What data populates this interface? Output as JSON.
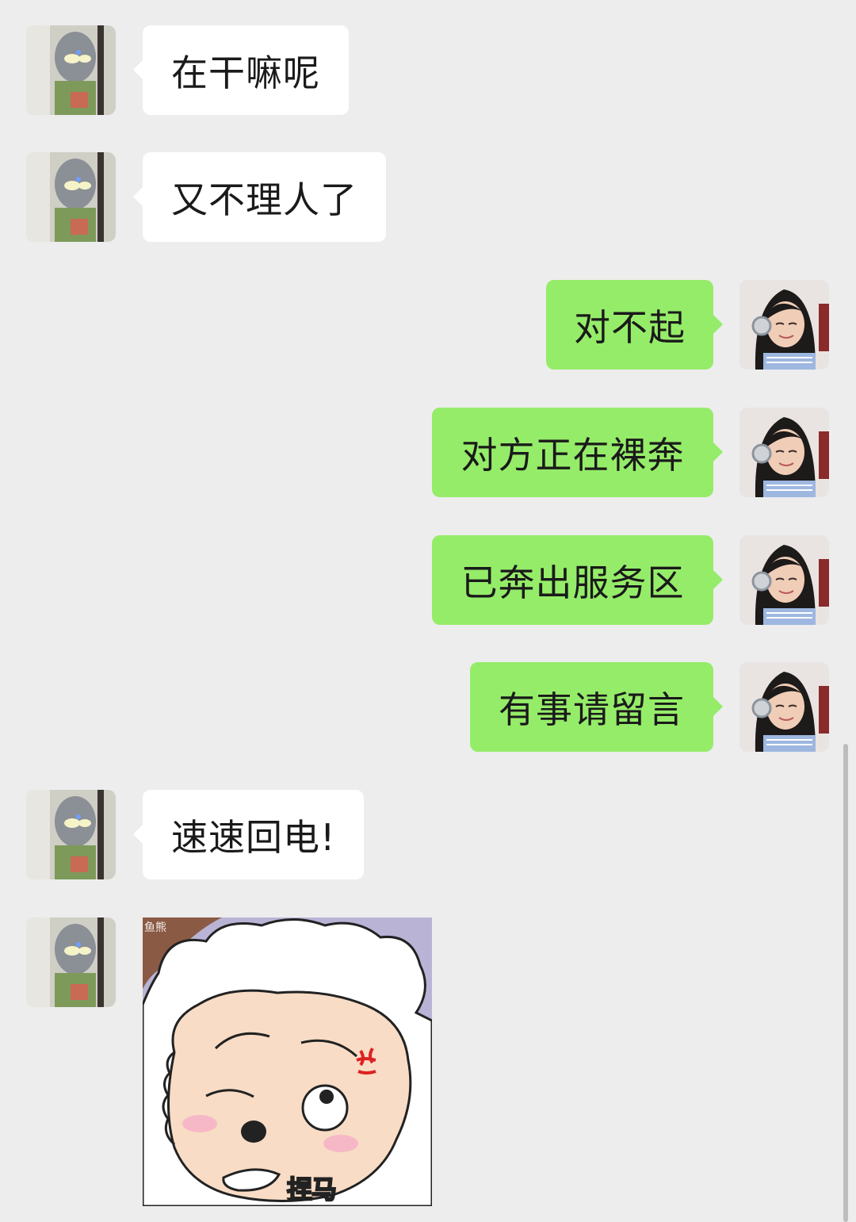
{
  "conversation": {
    "messages": [
      {
        "side": "incoming",
        "type": "text",
        "text": "在干嘛呢",
        "avatar": "contact-avatar"
      },
      {
        "side": "incoming",
        "type": "text",
        "text": "又不理人了",
        "avatar": "contact-avatar"
      },
      {
        "side": "outgoing",
        "type": "text",
        "text": "对不起",
        "avatar": "self-avatar"
      },
      {
        "side": "outgoing",
        "type": "text",
        "text": "对方正在裸奔",
        "avatar": "self-avatar"
      },
      {
        "side": "outgoing",
        "type": "text",
        "text": "已奔出服务区",
        "avatar": "self-avatar"
      },
      {
        "side": "outgoing",
        "type": "text",
        "text": "有事请留言",
        "avatar": "self-avatar"
      },
      {
        "side": "incoming",
        "type": "text",
        "text": "速速回电!",
        "avatar": "contact-avatar"
      },
      {
        "side": "incoming",
        "type": "sticker",
        "caption": "捏马",
        "watermark": "鱼熊",
        "avatar": "contact-avatar"
      }
    ]
  },
  "colors": {
    "background": "#ededed",
    "incoming_bubble": "#ffffff",
    "outgoing_bubble": "#95ec69",
    "text": "#1a1a1a"
  }
}
